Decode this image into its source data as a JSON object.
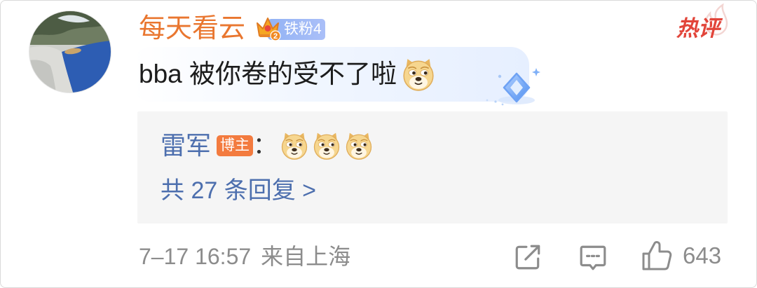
{
  "comment": {
    "avatar": {
      "icon": "avatar-photo"
    },
    "username": "每天看云",
    "fan_badge": {
      "icon": "crown-icon",
      "crown_level": "2",
      "label": "铁粉4"
    },
    "hot_label": "热评",
    "text": "bba 被你卷的受不了啦",
    "emoji_icon": "doge-emoji-icon",
    "decoration_icon": "diamond-gem-icon"
  },
  "reply_preview": {
    "author": "雷军",
    "author_badge": "博主",
    "separator": "：",
    "emoji_icons": [
      "doge-emoji-icon",
      "doge-emoji-icon",
      "doge-emoji-icon"
    ],
    "more_replies": "共 27 条回复 >"
  },
  "footer": {
    "time": "7–17 16:57",
    "source": "来自上海",
    "share_icon": "share-icon",
    "comment_icon": "comment-icon",
    "like_icon": "thumb-up-icon",
    "like_count": "643"
  },
  "colors": {
    "username": "#e9762f",
    "link_blue": "#4d6fae",
    "badge_orange": "#f37b3f",
    "hot_red": "#e2453a",
    "muted_gray": "#8c8c8c",
    "reply_bg": "#f5f5f5",
    "fan_badge_blue": "#93b3f4"
  }
}
